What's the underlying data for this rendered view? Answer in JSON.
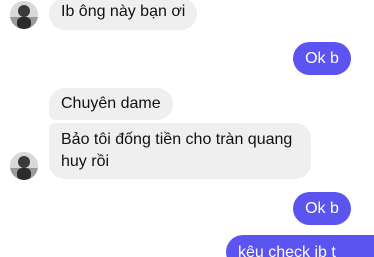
{
  "conversation": {
    "messages": [
      {
        "sender": "contact",
        "text": "Ib ông này bạn ơi"
      },
      {
        "sender": "me",
        "text": "Ok b"
      },
      {
        "sender": "contact",
        "text": "Chuyên dame"
      },
      {
        "sender": "contact",
        "lines": [
          "Bảo tôi đống tiền cho tràn quang",
          "huy rồi"
        ]
      },
      {
        "sender": "me",
        "text": "Ok b"
      },
      {
        "sender": "me",
        "text": "kêu check ib t"
      }
    ]
  },
  "colors": {
    "incoming_bubble": "#efefef",
    "outgoing_bubble": "#5b54f0",
    "incoming_text": "#111111",
    "outgoing_text": "#ffffff"
  },
  "icons": {
    "avatar": "contact-avatar-icon"
  }
}
